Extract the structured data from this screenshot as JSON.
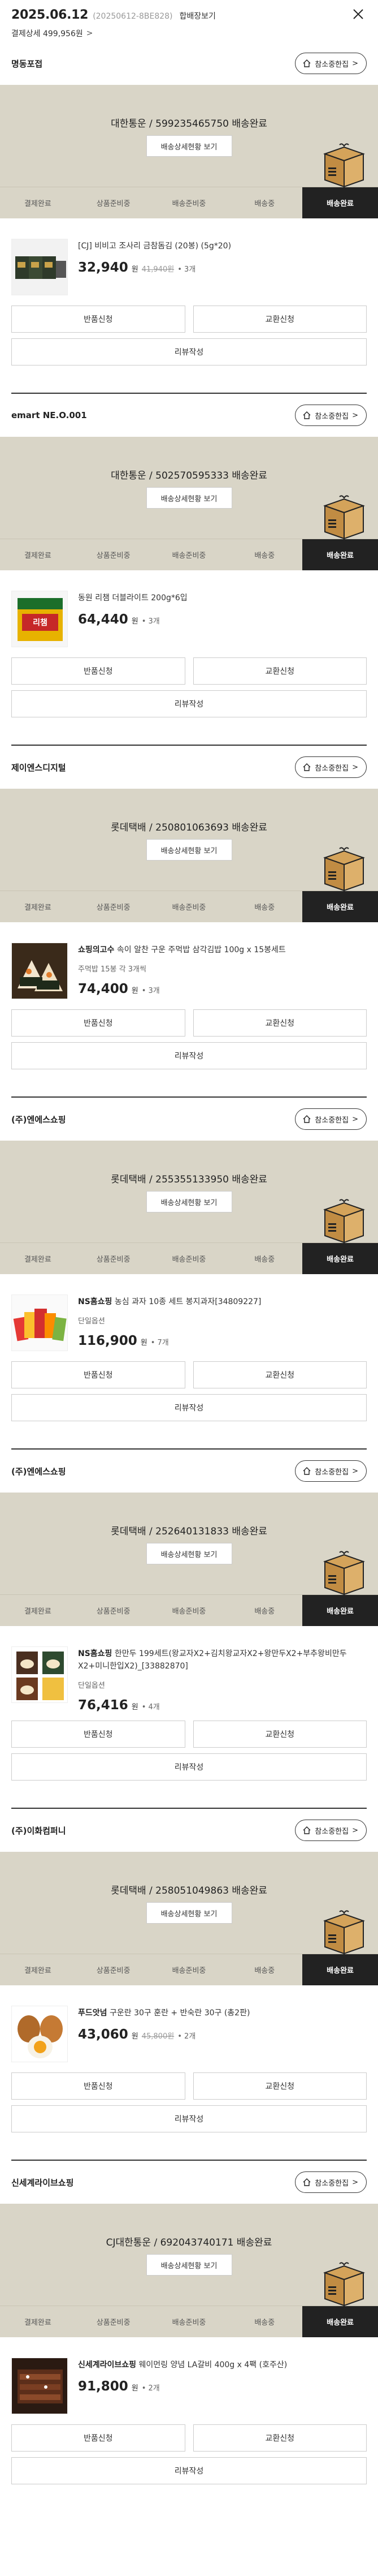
{
  "header": {
    "date": "2025.06.12",
    "order_no": "(20250612-8BE828)",
    "combined_label": "합배장보기",
    "sub": "결제상세 499,956원",
    "sub_chev": ">",
    "close_icon": "close-icon"
  },
  "labels": {
    "store": "참소중한집",
    "store_chev": ">",
    "detail": "배송상세현황 보기",
    "return": "반품신청",
    "exchange": "교환신청",
    "review": "리뷰작성",
    "steps": [
      "결제완료",
      "상품준비중",
      "배송준비중",
      "배송중",
      "배송완료"
    ]
  },
  "sections": [
    {
      "seller": "명동포접",
      "status": "대한통운 / 599235465750 배송완료",
      "product_brand": "",
      "product_name": "[CJ] 비비고 조사리 금참돔김 (20봉) (5g*20)",
      "option": "",
      "price": "32,940",
      "unit": "원",
      "orig": "41,940원",
      "qty": "• 3개",
      "thumb": "seaweed"
    },
    {
      "seller": "emart NE.O.001",
      "status": "대한통운 / 502570595333 배송완료",
      "product_brand": "",
      "product_name": "동원 리챔 더블라이트 200g*6입",
      "option": "",
      "price": "64,440",
      "unit": "원",
      "orig": "",
      "qty": "• 3개",
      "thumb": "ham"
    },
    {
      "seller": "제이엔스디지털",
      "status": "롯데택배 / 250801063693 배송완료",
      "product_brand": "쇼핑의고수",
      "product_name": " 속이 알찬 구운 주먹밥 삼각김밥 100g x 15봉세트",
      "option": "주먹밥 15봉 각 3개씩",
      "price": "74,400",
      "unit": "원",
      "orig": "",
      "qty": "• 3개",
      "thumb": "kimbap"
    },
    {
      "seller": "(주)엔에스쇼핑",
      "status": "롯데택배 / 255355133950 배송완료",
      "product_brand": "NS홈쇼핑",
      "product_name": " 농심 과자 10종 세트 봉지과자[34809227]",
      "option": "단일옵션",
      "price": "116,900",
      "unit": "원",
      "orig": "",
      "qty": "• 7개",
      "thumb": "snacks"
    },
    {
      "seller": "(주)엔에스쇼핑",
      "status": "롯데택배 / 252640131833 배송완료",
      "product_brand": "NS홈쇼핑",
      "product_name": " 한만두 199세트(왕교자X2+김치왕교자X2+왕만두X2+부추왕비만두X2+미니한입X2)_[33882870]",
      "option": "단일옵션",
      "price": "76,416",
      "unit": "원",
      "orig": "",
      "qty": "• 4개",
      "thumb": "dumpling"
    },
    {
      "seller": "(주)이화컴퍼니",
      "status": "롯데택배 / 258051049863 배송완료",
      "product_brand": "푸드앗넘",
      "product_name": " 구운란 30구 훈란 + 반숙란 30구 (총2판)",
      "option": "",
      "price": "43,060",
      "unit": "원",
      "orig": "45,800원",
      "qty": "• 2개",
      "thumb": "eggs"
    },
    {
      "seller": "신세계라이브쇼핑",
      "status": "CJ대한통운 / 692043740171 배송완료",
      "product_brand": "신세계라이브쇼핑",
      "product_name": " 웨이먼링 양념 LA갈비 400g x 4팩 (호주산)",
      "option": "",
      "price": "91,800",
      "unit": "원",
      "orig": "",
      "qty": "• 2개",
      "thumb": "galbi"
    }
  ]
}
